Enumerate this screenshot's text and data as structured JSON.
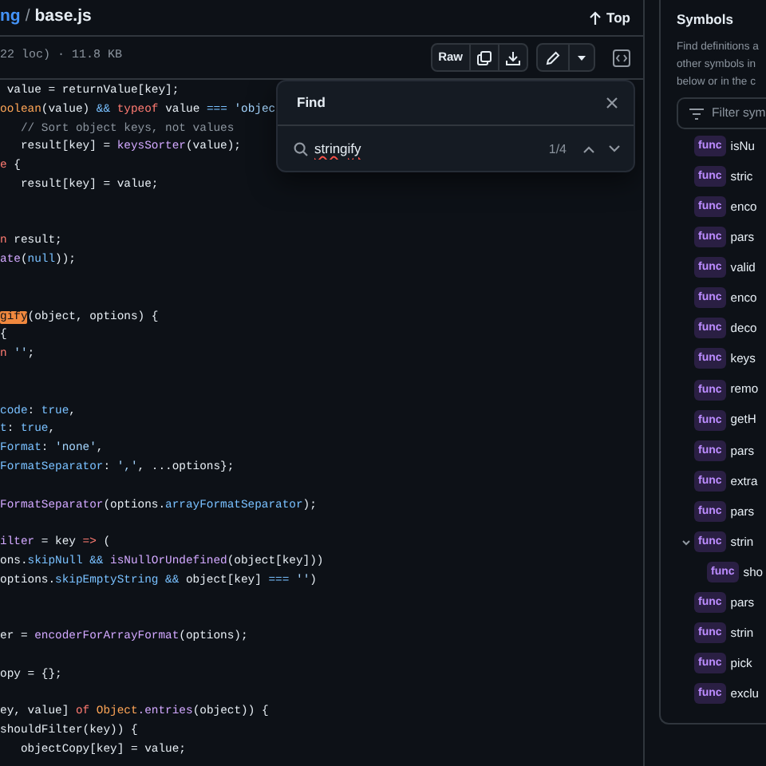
{
  "breadcrumb": {
    "parent": "ng",
    "separator": "/",
    "file": "base.js"
  },
  "top_button": {
    "label": "Top"
  },
  "file_info": "22 loc) · 11.8 KB",
  "toolbar": {
    "raw_label": "Raw"
  },
  "code_lines": [
    {
      "kind": "code",
      "tokens": [
        {
          "text": " value = returnValue[key];",
          "kind": "plain"
        }
      ]
    },
    {
      "kind": "code",
      "tokens": [
        {
          "text": "oolean",
          "kind": "class"
        },
        {
          "text": "(value) ",
          "kind": "plain"
        },
        {
          "text": "&& ",
          "kind": "const"
        },
        {
          "text": "typeof",
          "kind": "keyword"
        },
        {
          "text": " value ",
          "kind": "plain"
        },
        {
          "text": "=== ",
          "kind": "const"
        },
        {
          "text": "'objec",
          "kind": "string"
        }
      ]
    },
    {
      "kind": "code",
      "tokens": [
        {
          "text": "   // Sort object keys, not values",
          "kind": "comment"
        }
      ]
    },
    {
      "kind": "code",
      "tokens": [
        {
          "text": "   result[key] = ",
          "kind": "plain"
        },
        {
          "text": "keysSorter",
          "kind": "func"
        },
        {
          "text": "(value);",
          "kind": "plain"
        }
      ]
    },
    {
      "kind": "code",
      "tokens": [
        {
          "text": "e",
          "kind": "keyword"
        },
        {
          "text": " {",
          "kind": "plain"
        }
      ]
    },
    {
      "kind": "code",
      "tokens": [
        {
          "text": "   result[key] = value;",
          "kind": "plain"
        }
      ]
    },
    {
      "kind": "blank"
    },
    {
      "kind": "blank"
    },
    {
      "kind": "code",
      "tokens": [
        {
          "text": "n",
          "kind": "keyword"
        },
        {
          "text": " result;",
          "kind": "plain"
        }
      ]
    },
    {
      "kind": "code",
      "tokens": [
        {
          "text": "ate",
          "kind": "func"
        },
        {
          "text": "(",
          "kind": "plain"
        },
        {
          "text": "null",
          "kind": "const"
        },
        {
          "text": "));",
          "kind": "plain"
        }
      ]
    },
    {
      "kind": "blank"
    },
    {
      "kind": "blank"
    },
    {
      "kind": "code",
      "tokens": [
        {
          "text": "gify",
          "kind": "match"
        },
        {
          "text": "(object, options) {",
          "kind": "plain"
        }
      ]
    },
    {
      "kind": "code",
      "tokens": [
        {
          "text": "{",
          "kind": "plain"
        }
      ]
    },
    {
      "kind": "code",
      "tokens": [
        {
          "text": "n",
          "kind": "keyword"
        },
        {
          "text": " ''",
          "kind": "string"
        },
        {
          "text": ";",
          "kind": "plain"
        }
      ]
    },
    {
      "kind": "blank"
    },
    {
      "kind": "blank"
    },
    {
      "kind": "code",
      "tokens": [
        {
          "text": "code",
          "kind": "const"
        },
        {
          "text": ": ",
          "kind": "plain"
        },
        {
          "text": "true",
          "kind": "const"
        },
        {
          "text": ",",
          "kind": "plain"
        }
      ]
    },
    {
      "kind": "code",
      "tokens": [
        {
          "text": "t",
          "kind": "const"
        },
        {
          "text": ": ",
          "kind": "plain"
        },
        {
          "text": "true",
          "kind": "const"
        },
        {
          "text": ",",
          "kind": "plain"
        }
      ]
    },
    {
      "kind": "code",
      "tokens": [
        {
          "text": "Format",
          "kind": "const"
        },
        {
          "text": ": ",
          "kind": "plain"
        },
        {
          "text": "'none'",
          "kind": "string"
        },
        {
          "text": ",",
          "kind": "plain"
        }
      ]
    },
    {
      "kind": "code",
      "tokens": [
        {
          "text": "FormatSeparator",
          "kind": "const"
        },
        {
          "text": ": ",
          "kind": "plain"
        },
        {
          "text": "','",
          "kind": "string"
        },
        {
          "text": ", ...options};",
          "kind": "plain"
        }
      ]
    },
    {
      "kind": "blank"
    },
    {
      "kind": "code",
      "tokens": [
        {
          "text": "FormatSeparator",
          "kind": "func"
        },
        {
          "text": "(options.",
          "kind": "plain"
        },
        {
          "text": "arrayFormatSeparator",
          "kind": "const"
        },
        {
          "text": ");",
          "kind": "plain"
        }
      ]
    },
    {
      "kind": "blank"
    },
    {
      "kind": "code",
      "tokens": [
        {
          "text": "ilter",
          "kind": "func"
        },
        {
          "text": " = key ",
          "kind": "plain"
        },
        {
          "text": "=>",
          "kind": "keyword"
        },
        {
          "text": " (",
          "kind": "plain"
        }
      ]
    },
    {
      "kind": "code",
      "tokens": [
        {
          "text": "ons.",
          "kind": "plain"
        },
        {
          "text": "skipNull && ",
          "kind": "const"
        },
        {
          "text": "isNullOrUndefined",
          "kind": "func"
        },
        {
          "text": "(object[key]))",
          "kind": "plain"
        }
      ]
    },
    {
      "kind": "code",
      "tokens": [
        {
          "text": "options.",
          "kind": "plain"
        },
        {
          "text": "skipEmptyString &&",
          "kind": "const"
        },
        {
          "text": " object[key] ",
          "kind": "plain"
        },
        {
          "text": "===",
          "kind": "const"
        },
        {
          "text": " ''",
          "kind": "string"
        },
        {
          "text": ")",
          "kind": "plain"
        }
      ]
    },
    {
      "kind": "blank"
    },
    {
      "kind": "blank"
    },
    {
      "kind": "code",
      "tokens": [
        {
          "text": "er = ",
          "kind": "plain"
        },
        {
          "text": "encoderForArrayFormat",
          "kind": "func"
        },
        {
          "text": "(options);",
          "kind": "plain"
        }
      ]
    },
    {
      "kind": "blank"
    },
    {
      "kind": "code",
      "tokens": [
        {
          "text": "opy = {};",
          "kind": "plain"
        }
      ]
    },
    {
      "kind": "blank"
    },
    {
      "kind": "code",
      "tokens": [
        {
          "text": "ey, value] ",
          "kind": "plain"
        },
        {
          "text": "of ",
          "kind": "keyword"
        },
        {
          "text": "Object",
          "kind": "class"
        },
        {
          "text": ".entries",
          "kind": "func"
        },
        {
          "text": "(object)) {",
          "kind": "plain"
        }
      ]
    },
    {
      "kind": "code",
      "tokens": [
        {
          "text": "shouldFilter(key)) {",
          "kind": "plain"
        }
      ]
    },
    {
      "kind": "code",
      "tokens": [
        {
          "text": "   objectCopy[key] = value;",
          "kind": "plain"
        }
      ]
    }
  ],
  "find": {
    "title": "Find",
    "query": "stringify",
    "count": "1/4"
  },
  "symbols": {
    "title": "Symbols",
    "description_lines": [
      "Find definitions a",
      "other symbols in",
      "below or in the c"
    ],
    "filter_placeholder": "Filter sym",
    "items": [
      {
        "badge": "func",
        "name": "isNu",
        "expanded": false
      },
      {
        "badge": "func",
        "name": "stric",
        "expanded": false
      },
      {
        "badge": "func",
        "name": "enco",
        "expanded": false
      },
      {
        "badge": "func",
        "name": "pars",
        "expanded": false
      },
      {
        "badge": "func",
        "name": "valid",
        "expanded": false
      },
      {
        "badge": "func",
        "name": "enco",
        "expanded": false
      },
      {
        "badge": "func",
        "name": "deco",
        "expanded": false
      },
      {
        "badge": "func",
        "name": "keys",
        "expanded": false
      },
      {
        "badge": "func",
        "name": "remo",
        "expanded": false
      },
      {
        "badge": "func",
        "name": "getH",
        "expanded": false
      },
      {
        "badge": "func",
        "name": "pars",
        "expanded": false
      },
      {
        "badge": "func",
        "name": "extra",
        "expanded": false
      },
      {
        "badge": "func",
        "name": "pars",
        "expanded": false
      },
      {
        "badge": "func",
        "name": "strin",
        "expanded": true,
        "children": [
          {
            "badge": "func",
            "name": "sho",
            "expanded": false
          }
        ]
      },
      {
        "badge": "func",
        "name": "pars",
        "expanded": false
      },
      {
        "badge": "func",
        "name": "strin",
        "expanded": false
      },
      {
        "badge": "func",
        "name": "pick",
        "expanded": false
      },
      {
        "badge": "func",
        "name": "exclu",
        "expanded": false
      }
    ]
  }
}
